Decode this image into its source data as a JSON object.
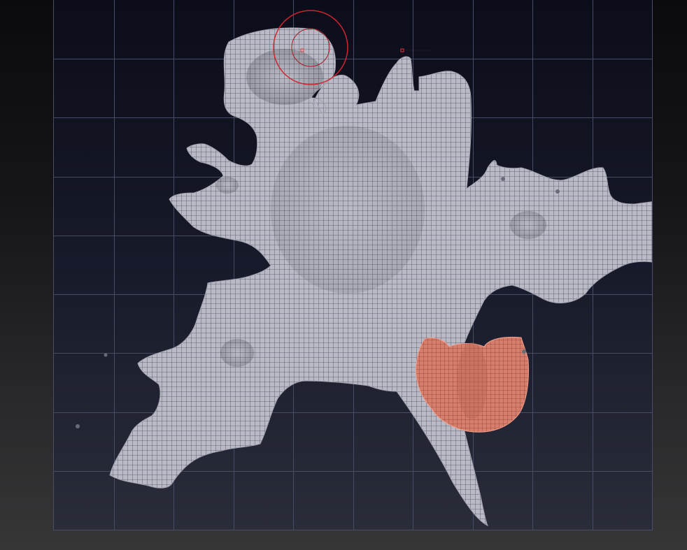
{
  "app": {
    "view": "uv-layout-viewport"
  },
  "viewport": {
    "background_top": "#0c0d1a",
    "background_bottom": "#2a2c3a",
    "grid_color": "#474b63",
    "grid_divisions": 10,
    "show_grid": true
  },
  "shells": [
    {
      "id": "body-shell",
      "fill": "#b9bac6",
      "line": "#4c4d5a",
      "state": "unselected"
    },
    {
      "id": "tongue-shell",
      "fill": "#d77f6c",
      "line": "#8a3f33",
      "state": "selected"
    }
  ],
  "gizmo": {
    "icon": "transform-gizmo-icon",
    "color": "#d1252e"
  }
}
